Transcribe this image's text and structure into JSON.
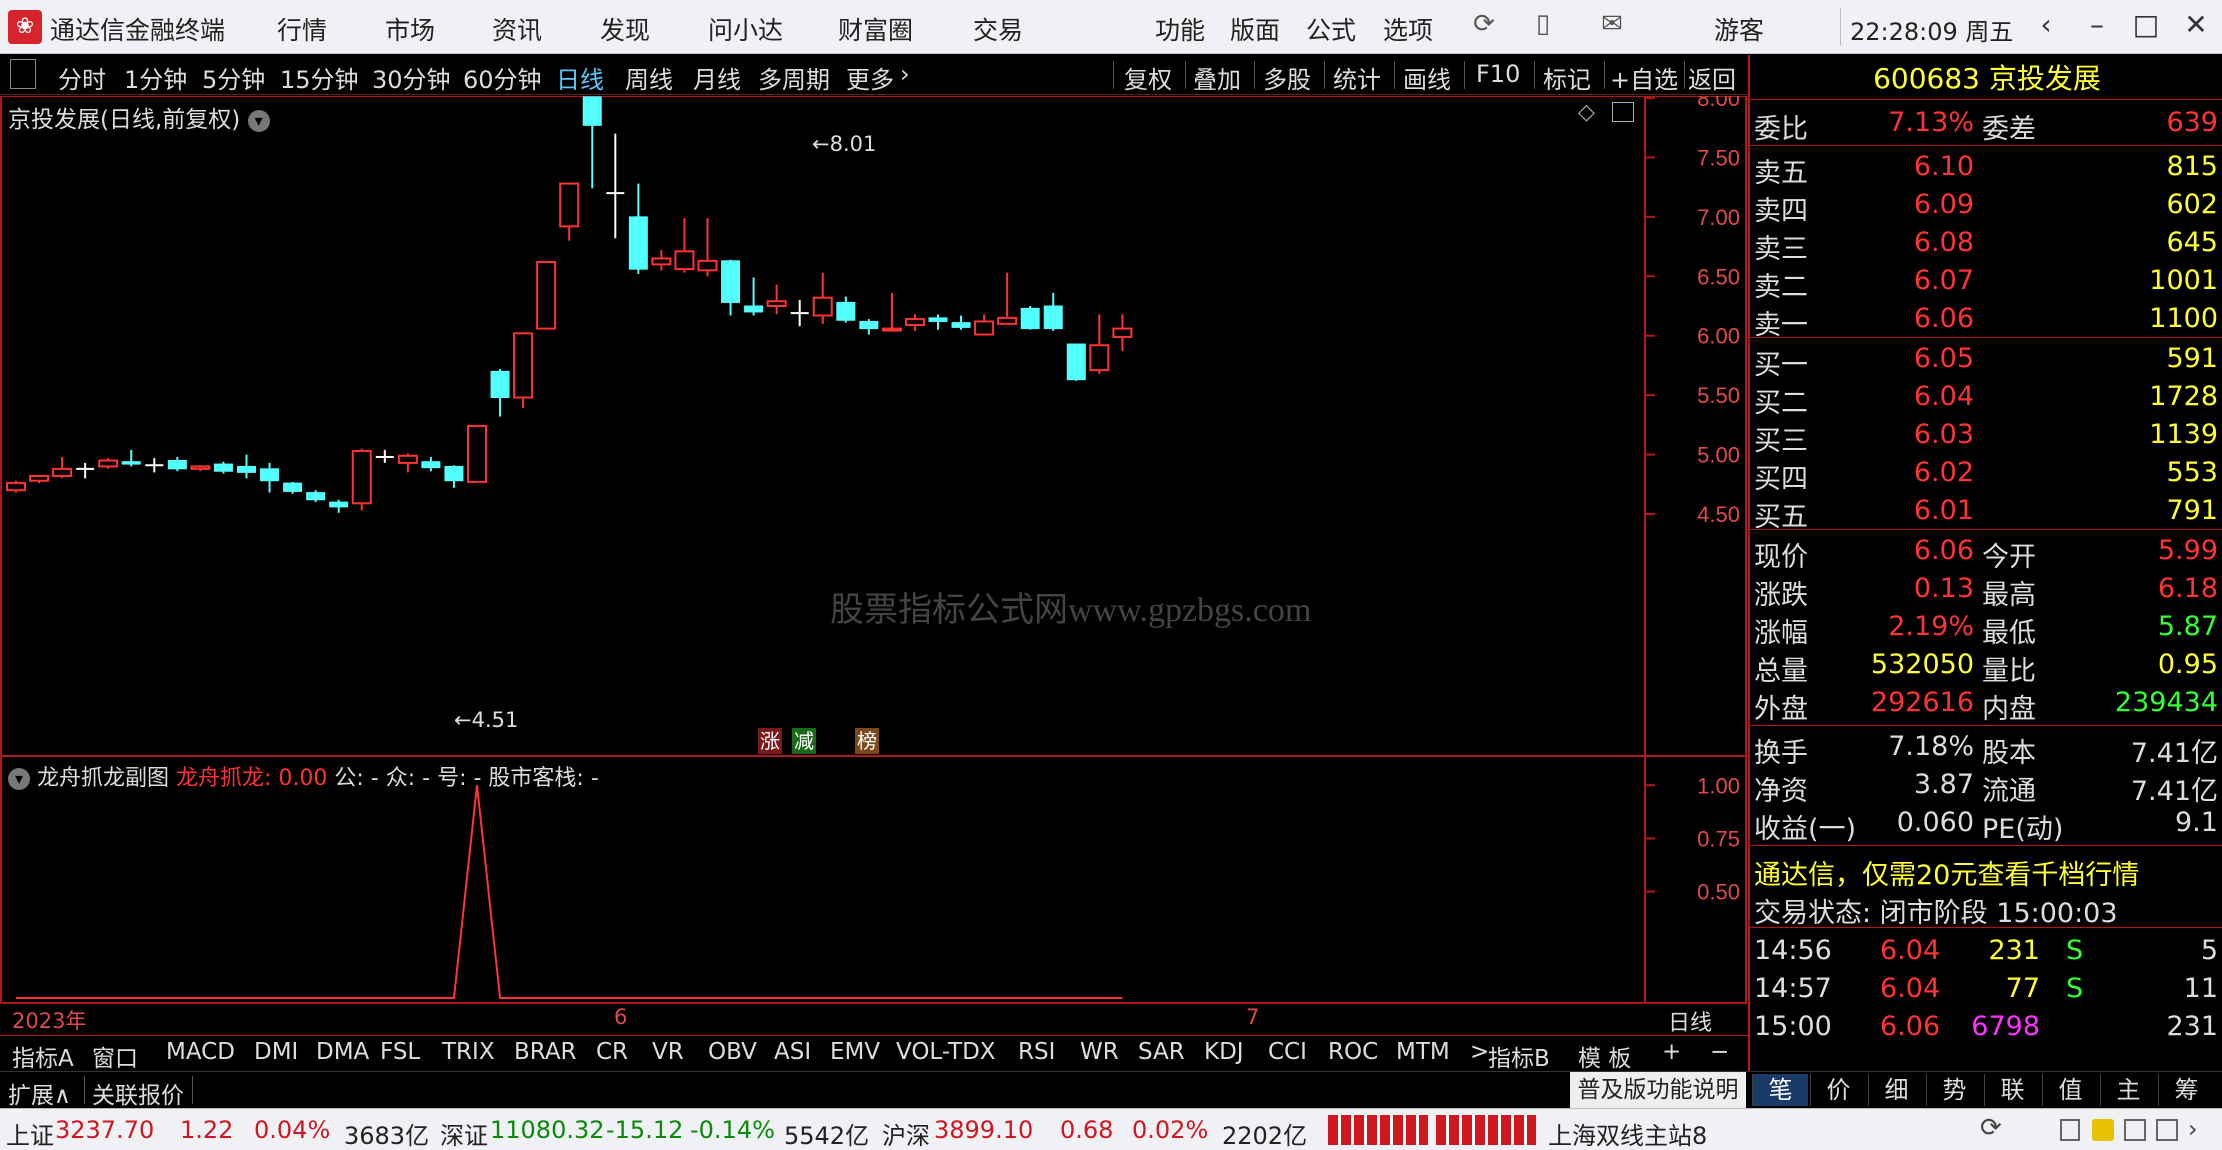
{
  "app": {
    "title": "通达信金融终端",
    "logo_glyph": "❀",
    "menu": [
      "行情",
      "市场",
      "资讯",
      "发现",
      "问小达",
      "财富圈",
      "交易"
    ],
    "right_menu": [
      "功能",
      "版面",
      "公式",
      "选项"
    ],
    "user": "游客",
    "clock": "22:28:09 周五"
  },
  "toolbar": {
    "periods": [
      "分时",
      "1分钟",
      "5分钟",
      "15分钟",
      "30分钟",
      "60分钟",
      "日线",
      "周线",
      "月线",
      "多周期",
      "更多"
    ],
    "active_period": "日线",
    "tools": [
      "复权",
      "叠加",
      "多股",
      "统计",
      "画线",
      "F10",
      "标记",
      "+自选",
      "返回"
    ]
  },
  "chart": {
    "header": "京投发展(日线,前复权)",
    "high_label": "8.01",
    "low_label": "4.51",
    "watermark": "股票指标公式网www.gpzbgs.com",
    "badges": [
      "涨",
      "减",
      "榜"
    ],
    "y_ticks": [
      "8.00",
      "7.50",
      "7.00",
      "6.50",
      "6.00",
      "5.50",
      "5.00",
      "4.50"
    ],
    "date_labels": [
      "2023年",
      "6",
      "7"
    ],
    "period_label": "日线",
    "colors": {
      "up": "#ff3333",
      "down": "#54ffff",
      "flat": "#ffffff",
      "grid": "#b01818",
      "axis_text": "#e24a4a"
    }
  },
  "chart_data": {
    "type": "candlestick",
    "title": "京投发展(日线,前复权)",
    "ylim": [
      4.4,
      8.1
    ],
    "candles": [
      {
        "o": 4.7,
        "h": 4.78,
        "l": 4.68,
        "c": 4.76
      },
      {
        "o": 4.78,
        "h": 4.82,
        "l": 4.76,
        "c": 4.82
      },
      {
        "o": 4.82,
        "h": 4.98,
        "l": 4.8,
        "c": 4.88
      },
      {
        "o": 4.88,
        "h": 4.93,
        "l": 4.8,
        "c": 4.88
      },
      {
        "o": 4.9,
        "h": 4.97,
        "l": 4.88,
        "c": 4.95
      },
      {
        "o": 4.94,
        "h": 5.04,
        "l": 4.9,
        "c": 4.92
      },
      {
        "o": 4.91,
        "h": 4.97,
        "l": 4.85,
        "c": 4.91
      },
      {
        "o": 4.95,
        "h": 4.98,
        "l": 4.86,
        "c": 4.88
      },
      {
        "o": 4.88,
        "h": 4.91,
        "l": 4.86,
        "c": 4.9
      },
      {
        "o": 4.92,
        "h": 4.94,
        "l": 4.84,
        "c": 4.86
      },
      {
        "o": 4.9,
        "h": 5.0,
        "l": 4.8,
        "c": 4.85
      },
      {
        "o": 4.88,
        "h": 4.93,
        "l": 4.68,
        "c": 4.78
      },
      {
        "o": 4.76,
        "h": 4.77,
        "l": 4.67,
        "c": 4.69
      },
      {
        "o": 4.68,
        "h": 4.7,
        "l": 4.6,
        "c": 4.62
      },
      {
        "o": 4.6,
        "h": 4.62,
        "l": 4.51,
        "c": 4.56
      },
      {
        "o": 4.59,
        "h": 5.05,
        "l": 4.53,
        "c": 5.03
      },
      {
        "o": 4.98,
        "h": 5.04,
        "l": 4.93,
        "c": 4.98
      },
      {
        "o": 4.93,
        "h": 5.01,
        "l": 4.85,
        "c": 4.99
      },
      {
        "o": 4.94,
        "h": 4.98,
        "l": 4.86,
        "c": 4.89
      },
      {
        "o": 4.9,
        "h": 4.91,
        "l": 4.72,
        "c": 4.78
      },
      {
        "o": 4.77,
        "h": 5.24,
        "l": 4.76,
        "c": 5.24
      },
      {
        "o": 5.7,
        "h": 5.72,
        "l": 5.32,
        "c": 5.48
      },
      {
        "o": 5.48,
        "h": 6.02,
        "l": 5.39,
        "c": 6.02
      },
      {
        "o": 6.06,
        "h": 6.62,
        "l": 6.06,
        "c": 6.62
      },
      {
        "o": 6.92,
        "h": 7.28,
        "l": 6.8,
        "c": 7.28
      },
      {
        "o": 8.01,
        "h": 8.01,
        "l": 7.24,
        "c": 7.77
      },
      {
        "o": 7.2,
        "h": 7.7,
        "l": 6.82,
        "c": 7.2
      },
      {
        "o": 7.0,
        "h": 7.28,
        "l": 6.52,
        "c": 6.56
      },
      {
        "o": 6.6,
        "h": 6.72,
        "l": 6.55,
        "c": 6.65
      },
      {
        "o": 6.56,
        "h": 6.99,
        "l": 6.53,
        "c": 6.71
      },
      {
        "o": 6.55,
        "h": 6.99,
        "l": 6.5,
        "c": 6.63
      },
      {
        "o": 6.63,
        "h": 6.64,
        "l": 6.17,
        "c": 6.28
      },
      {
        "o": 6.25,
        "h": 6.49,
        "l": 6.17,
        "c": 6.2
      },
      {
        "o": 6.25,
        "h": 6.43,
        "l": 6.18,
        "c": 6.29
      },
      {
        "o": 6.19,
        "h": 6.3,
        "l": 6.08,
        "c": 6.19
      },
      {
        "o": 6.17,
        "h": 6.53,
        "l": 6.1,
        "c": 6.32
      },
      {
        "o": 6.28,
        "h": 6.33,
        "l": 6.11,
        "c": 6.13
      },
      {
        "o": 6.12,
        "h": 6.14,
        "l": 6.01,
        "c": 6.06
      },
      {
        "o": 6.05,
        "h": 6.36,
        "l": 6.05,
        "c": 6.06
      },
      {
        "o": 6.09,
        "h": 6.18,
        "l": 6.04,
        "c": 6.14
      },
      {
        "o": 6.15,
        "h": 6.18,
        "l": 6.05,
        "c": 6.12
      },
      {
        "o": 6.11,
        "h": 6.17,
        "l": 6.05,
        "c": 6.07
      },
      {
        "o": 6.01,
        "h": 6.18,
        "l": 6.0,
        "c": 6.12
      },
      {
        "o": 6.1,
        "h": 6.53,
        "l": 6.09,
        "c": 6.15
      },
      {
        "o": 6.23,
        "h": 6.25,
        "l": 6.05,
        "c": 6.06
      },
      {
        "o": 6.25,
        "h": 6.36,
        "l": 6.04,
        "c": 6.06
      },
      {
        "o": 5.93,
        "h": 5.93,
        "l": 5.62,
        "c": 5.63
      },
      {
        "o": 5.71,
        "h": 6.18,
        "l": 5.68,
        "c": 5.92
      },
      {
        "o": 5.99,
        "h": 6.18,
        "l": 5.87,
        "c": 6.06
      }
    ],
    "sub_indicator": {
      "ylim": [
        0,
        1.1
      ],
      "y_ticks": [
        "1.00",
        "0.75",
        "0.50"
      ],
      "values": [
        0,
        0,
        0,
        0,
        0,
        0,
        0,
        0,
        0,
        0,
        0,
        0,
        0,
        0,
        0,
        0,
        0,
        0,
        0,
        0,
        1,
        0,
        0,
        0,
        0,
        0,
        0,
        0,
        0,
        0,
        0,
        0,
        0,
        0,
        0,
        0,
        0,
        0,
        0,
        0,
        0,
        0,
        0,
        0,
        0,
        0,
        0,
        0,
        0
      ]
    }
  },
  "sub_chart": {
    "header_name": "龙舟抓龙副图",
    "line_label": "龙舟抓龙: 0.00",
    "extra": "公: -  众: -  号: -  股市客栈: -"
  },
  "quote": {
    "code": "600683",
    "name": "京投发展",
    "weibi_label": "委比",
    "weibi": "7.13%",
    "weicha_label": "委差",
    "weicha": "639",
    "asks": [
      {
        "label": "卖五",
        "price": "6.10",
        "vol": "815"
      },
      {
        "label": "卖四",
        "price": "6.09",
        "vol": "602"
      },
      {
        "label": "卖三",
        "price": "6.08",
        "vol": "645"
      },
      {
        "label": "卖二",
        "price": "6.07",
        "vol": "1001"
      },
      {
        "label": "卖一",
        "price": "6.06",
        "vol": "1100"
      }
    ],
    "bids": [
      {
        "label": "买一",
        "price": "6.05",
        "vol": "591"
      },
      {
        "label": "买二",
        "price": "6.04",
        "vol": "1728"
      },
      {
        "label": "买三",
        "price": "6.03",
        "vol": "1139"
      },
      {
        "label": "买四",
        "price": "6.02",
        "vol": "553"
      },
      {
        "label": "买五",
        "price": "6.01",
        "vol": "791"
      }
    ],
    "stats": [
      {
        "l1": "现价",
        "v1": "6.06",
        "c1": "#ff3333",
        "l2": "今开",
        "v2": "5.99",
        "c2": "#ff3333"
      },
      {
        "l1": "涨跌",
        "v1": "0.13",
        "c1": "#ff3333",
        "l2": "最高",
        "v2": "6.18",
        "c2": "#ff3333"
      },
      {
        "l1": "涨幅",
        "v1": "2.19%",
        "c1": "#ff3333",
        "l2": "最低",
        "v2": "5.87",
        "c2": "#33ff33"
      },
      {
        "l1": "总量",
        "v1": "532050",
        "c1": "#ffff33",
        "l2": "量比",
        "v2": "0.95",
        "c2": "#ffff33"
      },
      {
        "l1": "外盘",
        "v1": "292616",
        "c1": "#ff3333",
        "l2": "内盘",
        "v2": "239434",
        "c2": "#33ff33"
      }
    ],
    "stats2": [
      {
        "l1": "换手",
        "v1": "7.18%",
        "l2": "股本",
        "v2": "7.41亿"
      },
      {
        "l1": "净资",
        "v1": "3.87",
        "l2": "流通",
        "v2": "7.41亿"
      },
      {
        "l1": "收益(一)",
        "v1": "0.060",
        "l2": "PE(动)",
        "v2": "9.1"
      }
    ],
    "promo": "通达信，仅需20元查看千档行情",
    "trade_status": "交易状态: 闭市阶段 15:00:03",
    "ticks": [
      {
        "time": "14:56",
        "price": "6.04",
        "vol": "231",
        "flag": "S",
        "n": "5",
        "vcolor": "#ffff33"
      },
      {
        "time": "14:57",
        "price": "6.04",
        "vol": "77",
        "flag": "S",
        "n": "11",
        "vcolor": "#ffff33"
      },
      {
        "time": "15:00",
        "price": "6.06",
        "vol": "6798",
        "flag": "",
        "n": "231",
        "vcolor": "#ff33ff"
      }
    ],
    "bottom_tabs": [
      "笔",
      "价",
      "细",
      "势",
      "联",
      "值",
      "主",
      "筹"
    ]
  },
  "indicator_tabs": {
    "first": "指标A",
    "items": [
      "窗口",
      "MACD",
      "DMI",
      "DMA",
      "FSL",
      "TRIX",
      "BRAR",
      "CR",
      "VR",
      "OBV",
      "ASI",
      "EMV",
      "VOL-TDX",
      "RSI",
      "WR",
      "SAR",
      "KDJ",
      "CCI",
      "ROC",
      "MTM"
    ],
    "more": ">",
    "second": "指标B",
    "template": "模 板",
    "plus": "+",
    "minus": "−"
  },
  "ext_bar": {
    "expand": "扩展∧",
    "related": "关联报价",
    "help": "普及版功能说明"
  },
  "status": {
    "sh_label": "上证",
    "sh_val": "3237.70",
    "sh_chg": "1.22",
    "sh_pct": "0.04%",
    "sh_amt": "3683亿",
    "sz_label": "深证",
    "sz_val": "11080.32",
    "sz_chg": "-15.12",
    "sz_pct": "-0.14%",
    "sz_amt": "5542亿",
    "hs_label": "沪深",
    "hs_val": "3899.10",
    "hs_chg": "0.68",
    "hs_pct": "0.02%",
    "hs_amt": "2202亿",
    "server": "上海双线主站8"
  }
}
